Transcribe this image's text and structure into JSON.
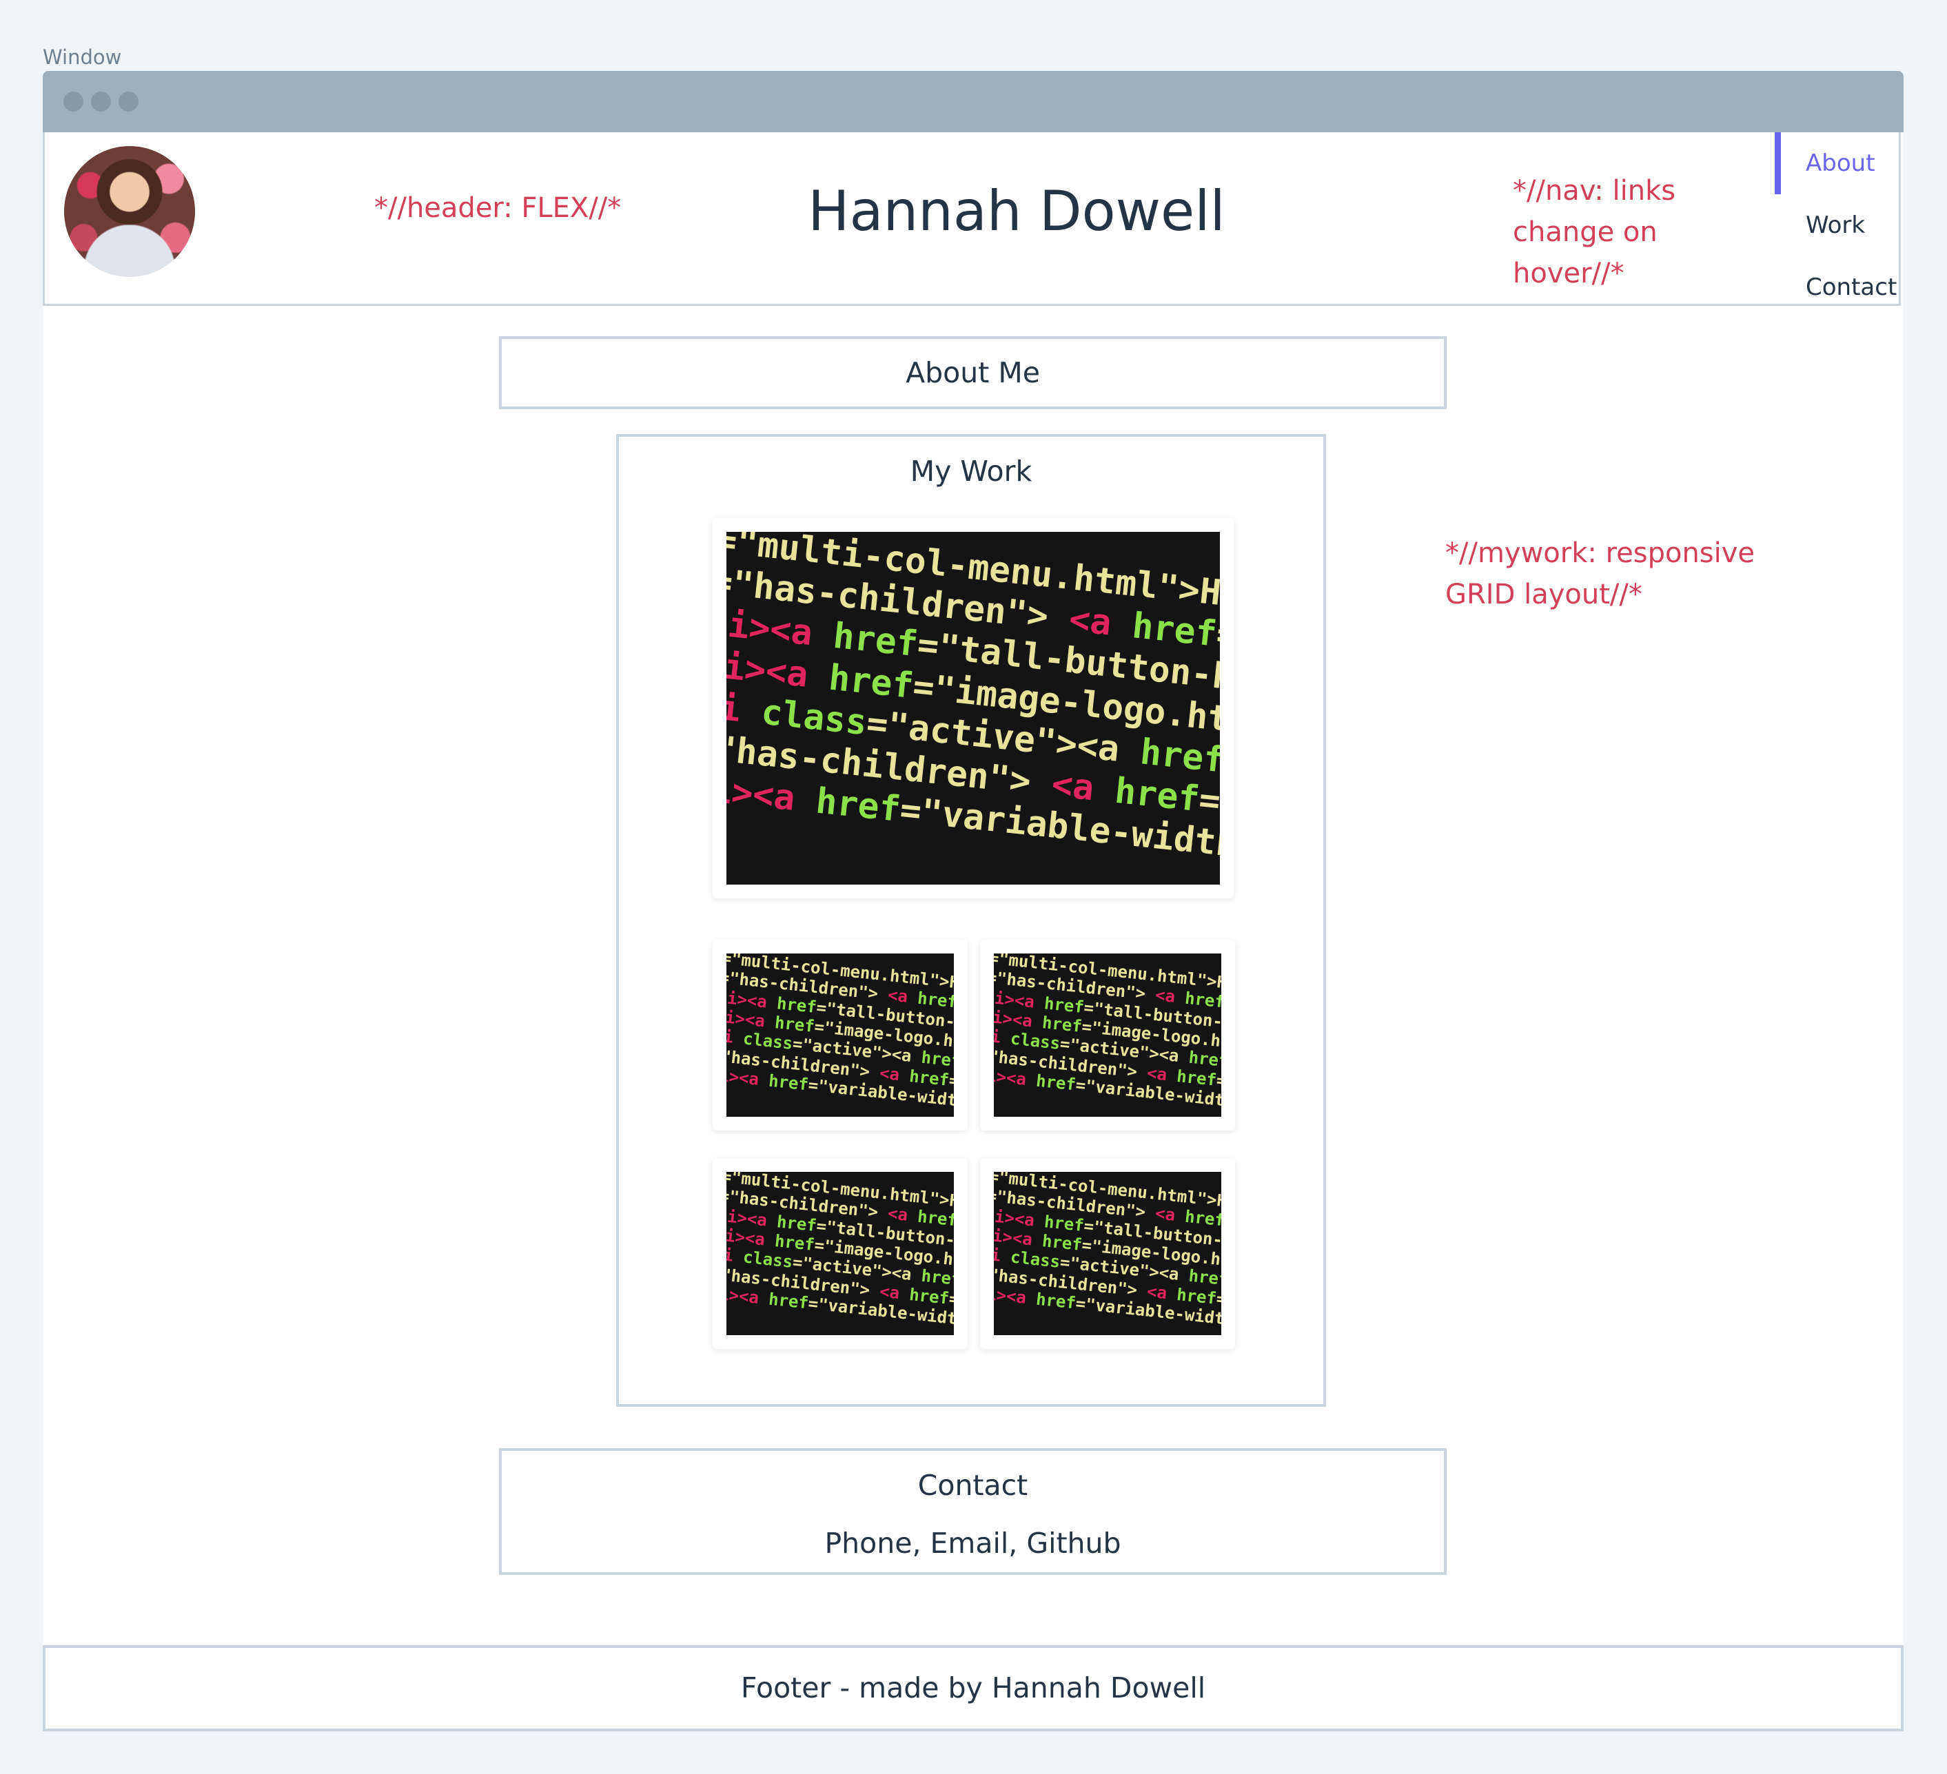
{
  "window_label": "Window",
  "header": {
    "title": "Hannah Dowell",
    "note": "*//header: FLEX//*",
    "nav_note": "*//nav: links change on hover//*",
    "nav": [
      {
        "label": "About",
        "active": true
      },
      {
        "label": "Work",
        "active": false
      },
      {
        "label": "Contact",
        "active": false
      }
    ]
  },
  "about": {
    "title": "About Me"
  },
  "work": {
    "title": "My Work",
    "note": "*//mywork: responsive GRID layout//*"
  },
  "contact": {
    "title": "Contact",
    "details": "Phone, Email, Github"
  },
  "footer": {
    "text": "Footer - made by Hannah Dowell"
  },
  "colors": {
    "accent": "#6a64ea",
    "annotation": "#d33e58",
    "border": "#c9d4de",
    "titlebar": "#9eafbd"
  }
}
